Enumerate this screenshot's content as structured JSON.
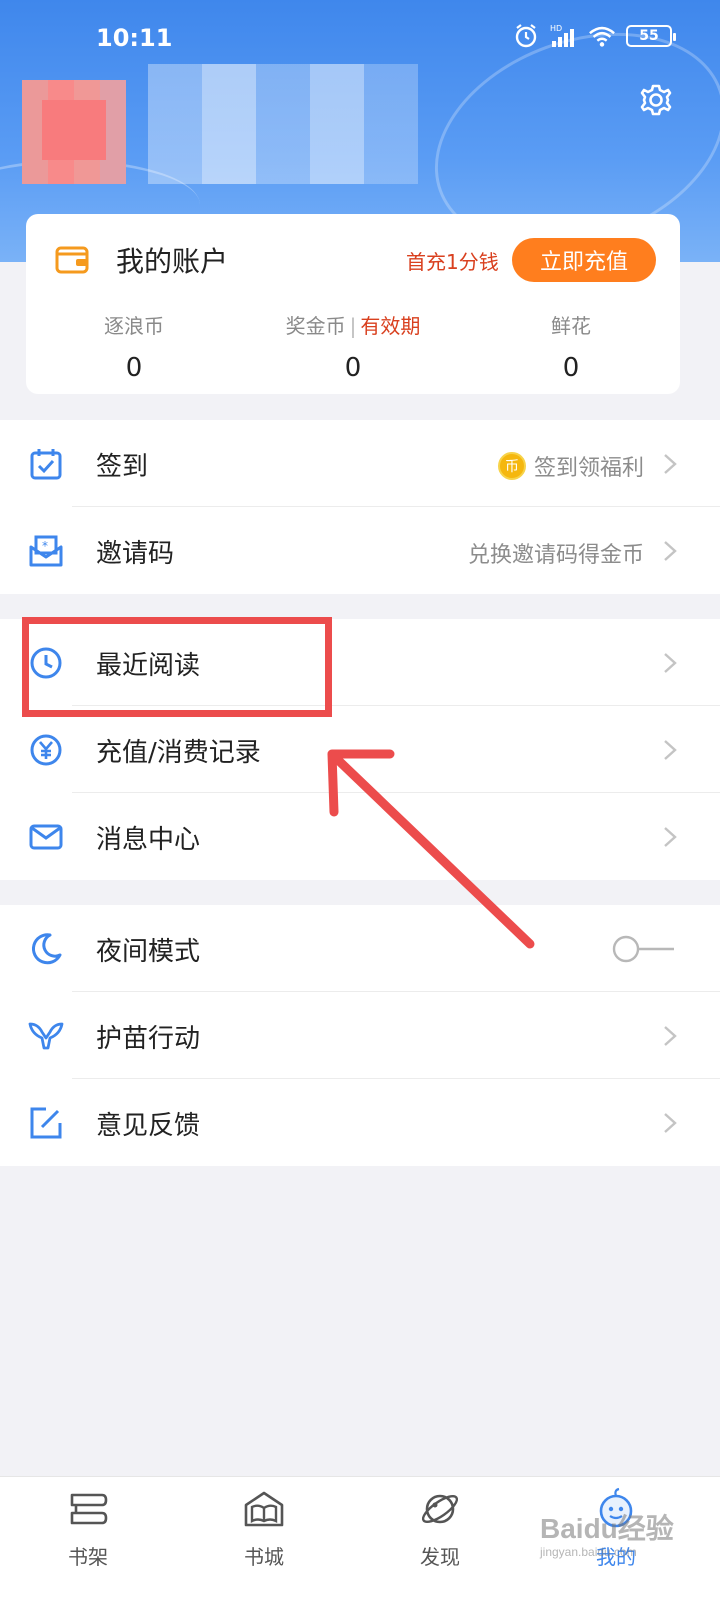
{
  "status_bar": {
    "time": "10:11",
    "battery": "55",
    "network": "HD"
  },
  "account": {
    "title": "我的账户",
    "first_charge": "首充1分钱",
    "charge_button": "立即充值",
    "stats": [
      {
        "label": "逐浪币",
        "value": "0"
      },
      {
        "label": "奖金币",
        "valid_label": "有效期",
        "value": "0"
      },
      {
        "label": "鲜花",
        "value": "0"
      }
    ]
  },
  "group1": [
    {
      "label": "签到",
      "icon": "calendar-check-icon",
      "right": "签到领福利",
      "coin": "币"
    },
    {
      "label": "邀请码",
      "icon": "invite-envelope-icon",
      "right": "兑换邀请码得金币"
    }
  ],
  "group2": [
    {
      "label": "最近阅读",
      "icon": "clock-icon"
    },
    {
      "label": "充值/消费记录",
      "icon": "yen-icon"
    },
    {
      "label": "消息中心",
      "icon": "mail-icon"
    }
  ],
  "group3": [
    {
      "label": "夜间模式",
      "icon": "moon-icon",
      "toggle": false
    },
    {
      "label": "护苗行动",
      "icon": "whale-tail-icon"
    },
    {
      "label": "意见反馈",
      "icon": "edit-icon"
    }
  ],
  "bottom_nav": [
    {
      "label": "书架",
      "icon": "bookshelf-icon"
    },
    {
      "label": "书城",
      "icon": "bookstore-icon"
    },
    {
      "label": "发现",
      "icon": "planet-icon"
    },
    {
      "label": "我的",
      "icon": "profile-icon",
      "active": true
    }
  ],
  "colors": {
    "accent": "#3e86ec",
    "orange": "#ff7e1e",
    "red_text": "#d9401f",
    "annotation": "#ec4c4c"
  },
  "watermark": {
    "main": "Baidu经验",
    "sub": "jingyan.baidu.com"
  }
}
